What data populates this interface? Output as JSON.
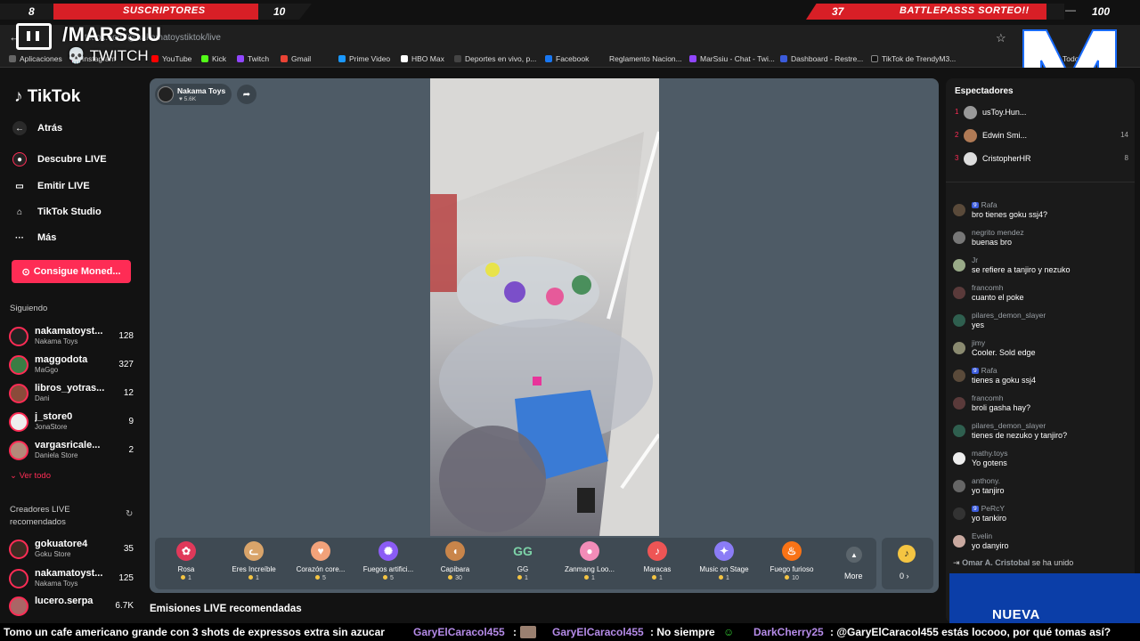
{
  "overlay": {
    "left_num": "8",
    "subs_label": "SUSCRIPTORES",
    "subs_count": "10",
    "bp_num": "37",
    "bp_label": "BATTLEPASSS SORTEO!!",
    "bp_goal": "100",
    "channel": "/MARSSIU",
    "platform": "TWITCH",
    "logo_letter": "M",
    "colors": {
      "accent_red": "#d81f26",
      "tiktok_pink": "#fe2c55",
      "nueva_blue": "#0b3ea8"
    }
  },
  "browser": {
    "url": "tiktok.com/@nakamatoystiktok/live",
    "bookmarks": [
      "Aplicaciones",
      "Instagram",
      "YouTube",
      "Kick",
      "Twitch",
      "Gmail",
      "Prime Video",
      "HBO Max",
      "Deportes en vivo, p...",
      "Facebook",
      "Reglamento Nacion...",
      "MarSsiu - Chat - Twi...",
      "Dashboard - Restre...",
      "TikTok de TrendyM3...",
      "Todos"
    ]
  },
  "sidebar": {
    "logo": "TikTok",
    "back": "Atrás",
    "nav": [
      "Descubre LIVE",
      "Emitir LIVE",
      "TikTok Studio",
      "Más"
    ],
    "coins_button": "Consigue Moned...",
    "following_title": "Siguiendo",
    "following": [
      {
        "name": "nakamatoyst...",
        "sub": "Nakama Toys",
        "count": "128"
      },
      {
        "name": "maggodota",
        "sub": "MaGgo",
        "count": "327"
      },
      {
        "name": "libros_yotras...",
        "sub": "Dani",
        "count": "12"
      },
      {
        "name": "j_store0",
        "sub": "JonaStore",
        "count": "9"
      },
      {
        "name": "vargasricale...",
        "sub": "Daniela Store",
        "count": "2"
      }
    ],
    "see_all": "Ver todo",
    "recommended_title": "Creadores LIVE recomendados",
    "recommended": [
      {
        "name": "gokuatore4",
        "sub": "Goku Store",
        "count": "35"
      },
      {
        "name": "nakamatoyst...",
        "sub": "Nakama Toys",
        "count": "125"
      },
      {
        "name": "lucero.serpa",
        "sub": "",
        "count": "6.7K"
      }
    ]
  },
  "stage": {
    "host_name": "Nakama Toys",
    "host_likes": "5.6K",
    "gifts": [
      {
        "name": "Rosa",
        "price": "1",
        "icon": "rose",
        "color": "#e0395a"
      },
      {
        "name": "Eres Increíble",
        "price": "1",
        "icon": "cat",
        "color": "#d9a46a"
      },
      {
        "name": "Corazón core...",
        "price": "5",
        "icon": "finger-heart",
        "color": "#f2a27a"
      },
      {
        "name": "Fuegos artifici...",
        "price": "5",
        "icon": "fireworks",
        "color": "#8b5cf6"
      },
      {
        "name": "Capibara",
        "price": "30",
        "icon": "capybara",
        "color": "#c9854a"
      },
      {
        "name": "GG",
        "price": "1",
        "icon": "gg",
        "color": "#7dd3a8"
      },
      {
        "name": "Zanmang Loo...",
        "price": "1",
        "icon": "zanmang",
        "color": "#f28cb8"
      },
      {
        "name": "Maracas",
        "price": "1",
        "icon": "maracas",
        "color": "#e55"
      },
      {
        "name": "Music on Stage",
        "price": "1",
        "icon": "music",
        "color": "#8b7cf6"
      },
      {
        "name": "Fuego furioso",
        "price": "10",
        "icon": "fire",
        "color": "#f97316"
      }
    ],
    "more_label": "More",
    "wallet_balance": "0",
    "recommended_heading": "Emisiones LIVE recomendadas"
  },
  "viewers": {
    "title": "Espectadores",
    "list": [
      {
        "rank": "1",
        "name": "usToy.Hun...",
        "score": ""
      },
      {
        "rank": "2",
        "name": "Edwin Smi...",
        "score": "14"
      },
      {
        "rank": "3",
        "name": "CristopherHR",
        "score": "8"
      }
    ]
  },
  "chat": {
    "messages": [
      {
        "user": "Rafa",
        "badge": "9",
        "text": "bro tienes goku ssj4?"
      },
      {
        "user": "negrito mendez",
        "badge": "",
        "text": "buenas bro"
      },
      {
        "user": "Jr",
        "badge": "",
        "text": "se refiere a tanjiro y nezuko"
      },
      {
        "user": "francomh",
        "badge": "",
        "text": "cuanto el poke"
      },
      {
        "user": "pilares_demon_slayer",
        "badge": "",
        "text": "yes"
      },
      {
        "user": "jimy",
        "badge": "",
        "text": "Cooler. Sold edge"
      },
      {
        "user": "Rafa",
        "badge": "9",
        "text": "tienes a goku ssj4"
      },
      {
        "user": "francomh",
        "badge": "",
        "text": "broli gasha hay?"
      },
      {
        "user": "pilares_demon_slayer",
        "badge": "",
        "text": "tienes de nezuko y tanjiro?"
      },
      {
        "user": "mathy.toys",
        "badge": "",
        "text": "Yo gotens"
      },
      {
        "user": "anthony.",
        "badge": "",
        "text": "yo tanjiro"
      },
      {
        "user": "PeRcY",
        "badge": "9",
        "text": "yo tankiro"
      },
      {
        "user": "Evelin",
        "badge": "",
        "text": "yo danyiro"
      }
    ],
    "join_user": "Omar A. Cristobal",
    "join_text": "se ha unido"
  },
  "nueva_label": "NUEVA",
  "ticker": [
    {
      "user": "",
      "text": "Tomo un cafe americano grande con 3 shots de expressos extra sin azucar"
    },
    {
      "user": "GaryElCaracol455",
      "text": ":"
    },
    {
      "user": "GaryElCaracol455",
      "text": ": No siempre"
    },
    {
      "user": "DarkCherry25",
      "text": ": @GaryElCaracol455 estás locooo, por qué tomas así?"
    }
  ]
}
